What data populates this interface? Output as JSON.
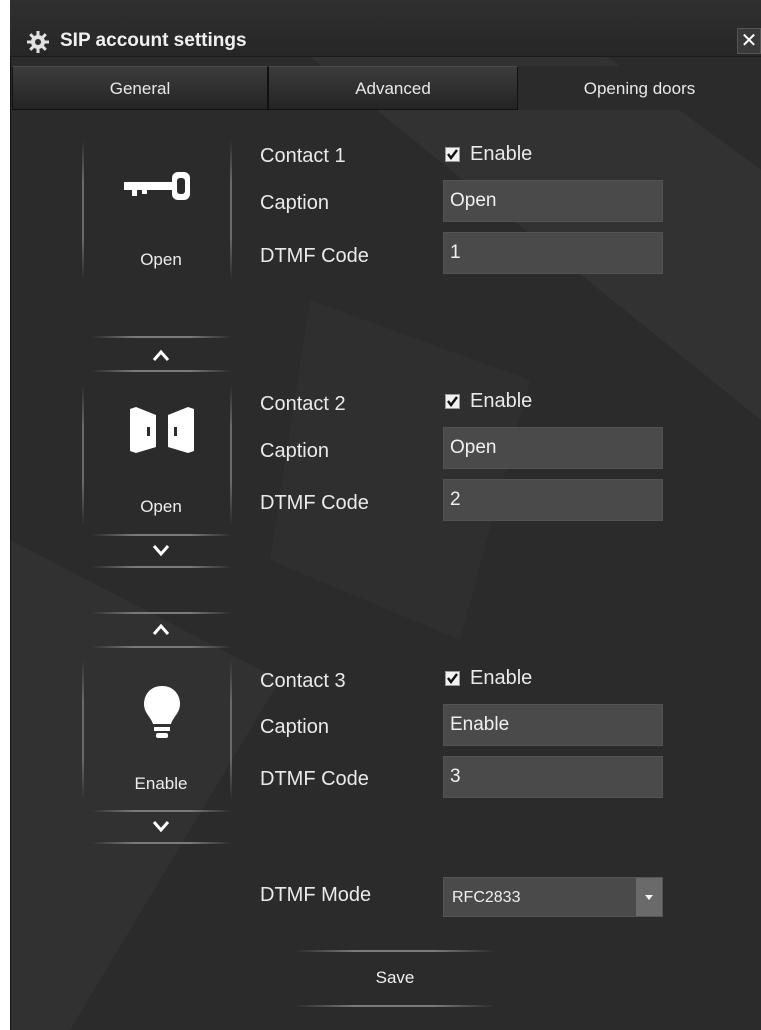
{
  "window": {
    "title": "SIP account settings",
    "close_glyph": "✕"
  },
  "tabs": [
    {
      "label": "General",
      "active": false
    },
    {
      "label": "Advanced",
      "active": false
    },
    {
      "label": "Opening doors",
      "active": true
    }
  ],
  "contacts": [
    {
      "title": "Contact 1",
      "enable_label": "Enable",
      "enabled": true,
      "caption_label": "Caption",
      "caption": "Open",
      "dtmf_label": "DTMF Code",
      "dtmf": "1",
      "icon": "key-icon",
      "card_label": "Open"
    },
    {
      "title": "Contact 2",
      "enable_label": "Enable",
      "enabled": true,
      "caption_label": "Caption",
      "caption": "Open",
      "dtmf_label": "DTMF Code",
      "dtmf": "2",
      "icon": "door-icon",
      "card_label": "Open"
    },
    {
      "title": "Contact 3",
      "enable_label": "Enable",
      "enabled": true,
      "caption_label": "Caption",
      "caption": "Enable",
      "dtmf_label": "DTMF Code",
      "dtmf": "3",
      "icon": "lightbulb-icon",
      "card_label": "Enable"
    }
  ],
  "dtmf_mode": {
    "label": "DTMF Mode",
    "value": "RFC2833"
  },
  "save_label": "Save",
  "colors": {
    "background": "#2b2b2b",
    "field": "#4a4a4a",
    "text": "#eaeaea"
  }
}
